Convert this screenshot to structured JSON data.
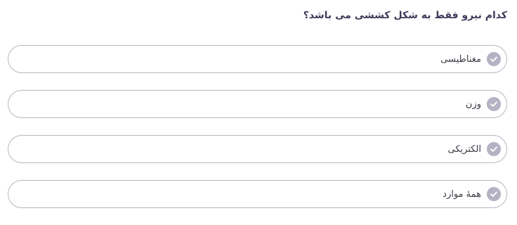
{
  "question": {
    "text": "کدام نیرو فقط به شکل کششی می باشد؟"
  },
  "options": [
    {
      "label": "مغناطیسی",
      "icon": "check-circle-icon"
    },
    {
      "label": "وزن",
      "icon": "check-circle-icon"
    },
    {
      "label": "الکتریکی",
      "icon": "check-circle-icon"
    },
    {
      "label": "همهٔ موارد",
      "icon": "check-circle-icon"
    }
  ],
  "colors": {
    "question_text": "#3f3d5b",
    "option_border": "#b7b5c2",
    "check_fill": "#b4b2c3"
  }
}
